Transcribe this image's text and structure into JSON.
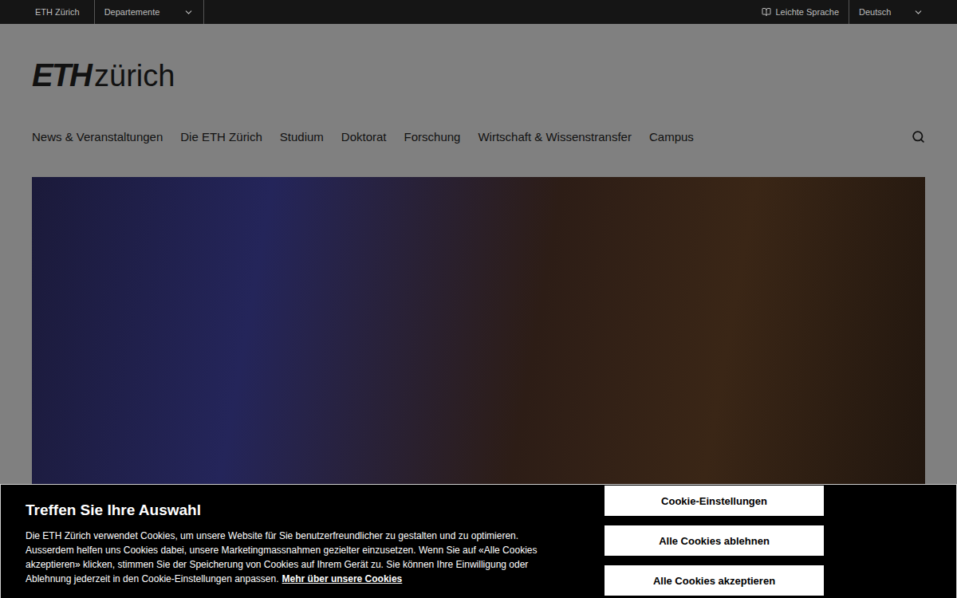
{
  "top_bar": {
    "home": "ETH Zürich",
    "departments": "Departemente",
    "easy_language": "Leichte Sprache",
    "language": "Deutsch"
  },
  "logo": {
    "bold": "ETH",
    "light": "zürich"
  },
  "nav": {
    "items": [
      "News & Veranstaltungen",
      "Die ETH Zürich",
      "Studium",
      "Doktorat",
      "Forschung",
      "Wirtschaft & Wissenstransfer",
      "Campus"
    ]
  },
  "cookie_banner": {
    "title": "Treffen Sie Ihre Auswahl",
    "text": "Die ETH Zürich verwendet Cookies, um unsere Website für Sie benutzerfreundlicher zu gestalten und zu optimieren. Ausserdem helfen uns Cookies dabei, unsere Marketingmassnahmen gezielter einzusetzen. Wenn Sie auf «Alle Cookies akzeptieren» klicken, stimmen Sie der Speicherung von Cookies auf Ihrem Gerät zu. Sie können Ihre Einwilligung oder Ablehnung jederzeit in den Cookie-Einstellungen anpassen.",
    "link": "Mehr über unsere Cookies",
    "buttons": [
      "Cookie-Einstellungen",
      "Alle Cookies ablehnen",
      "Alle Cookies akzeptieren"
    ]
  }
}
